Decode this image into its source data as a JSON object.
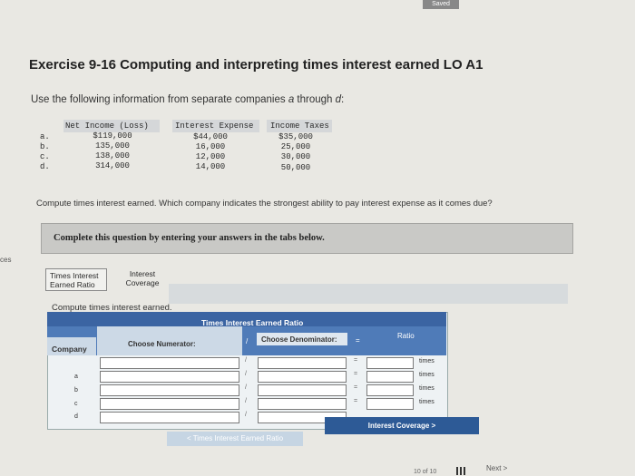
{
  "status": {
    "saved": "Saved"
  },
  "side_fragment": "ces",
  "exercise": {
    "title": "Exercise 9-16 Computing and interpreting times interest earned LO A1",
    "intro_prefix": "Use the following information from separate companies ",
    "intro_em": "a",
    "intro_mid": " through ",
    "intro_em2": "d",
    "intro_suffix": ":"
  },
  "data_table": {
    "headers": [
      "Net Income (Loss)",
      "Interest Expense",
      "Income Taxes"
    ],
    "rows": [
      {
        "label": "a.",
        "net_income": "$119,000",
        "interest_expense": "$44,000",
        "income_taxes": "$35,000"
      },
      {
        "label": "b.",
        "net_income": "135,000",
        "interest_expense": "16,000",
        "income_taxes": "25,000"
      },
      {
        "label": "c.",
        "net_income": "138,000",
        "interest_expense": "12,000",
        "income_taxes": "30,000"
      },
      {
        "label": "d.",
        "net_income": "314,000",
        "interest_expense": "14,000",
        "income_taxes": "50,000"
      }
    ]
  },
  "question": "Compute times interest earned. Which company indicates the strongest ability to pay interest expense as it comes due?",
  "banner": "Complete this question by entering your answers in the tabs below.",
  "tabs": [
    {
      "label_line1": "Times Interest",
      "label_line2": "Earned Ratio",
      "active": true
    },
    {
      "label_line1": "Interest",
      "label_line2": "Coverage",
      "active": false
    }
  ],
  "instruction": "Compute times interest earned.",
  "grid": {
    "title": "Times Interest Earned Ratio",
    "col_company": "Company",
    "col_numerator": "Choose Numerator:",
    "divide_symbol": "/",
    "col_denominator": "Choose Denominator:",
    "equals_symbol": "=",
    "col_ratio": "Ratio",
    "unit": "times",
    "rows": [
      {
        "company": "",
        "numerator": "",
        "denominator": "",
        "ratio": "",
        "unit": "times"
      },
      {
        "company": "a",
        "numerator": "",
        "denominator": "",
        "ratio": "",
        "unit": "times"
      },
      {
        "company": "b",
        "numerator": "",
        "denominator": "",
        "ratio": "",
        "unit": "times"
      },
      {
        "company": "c",
        "numerator": "",
        "denominator": "",
        "ratio": "",
        "unit": "times"
      },
      {
        "company": "d",
        "numerator": "",
        "denominator": "",
        "ratio": "",
        "unit": ""
      }
    ]
  },
  "nav": {
    "prev_label": "< Times Interest Earned Ratio",
    "next_label": "Interest Coverage >"
  },
  "footer": {
    "pager": "10 of 10",
    "next_link": "Next >"
  }
}
